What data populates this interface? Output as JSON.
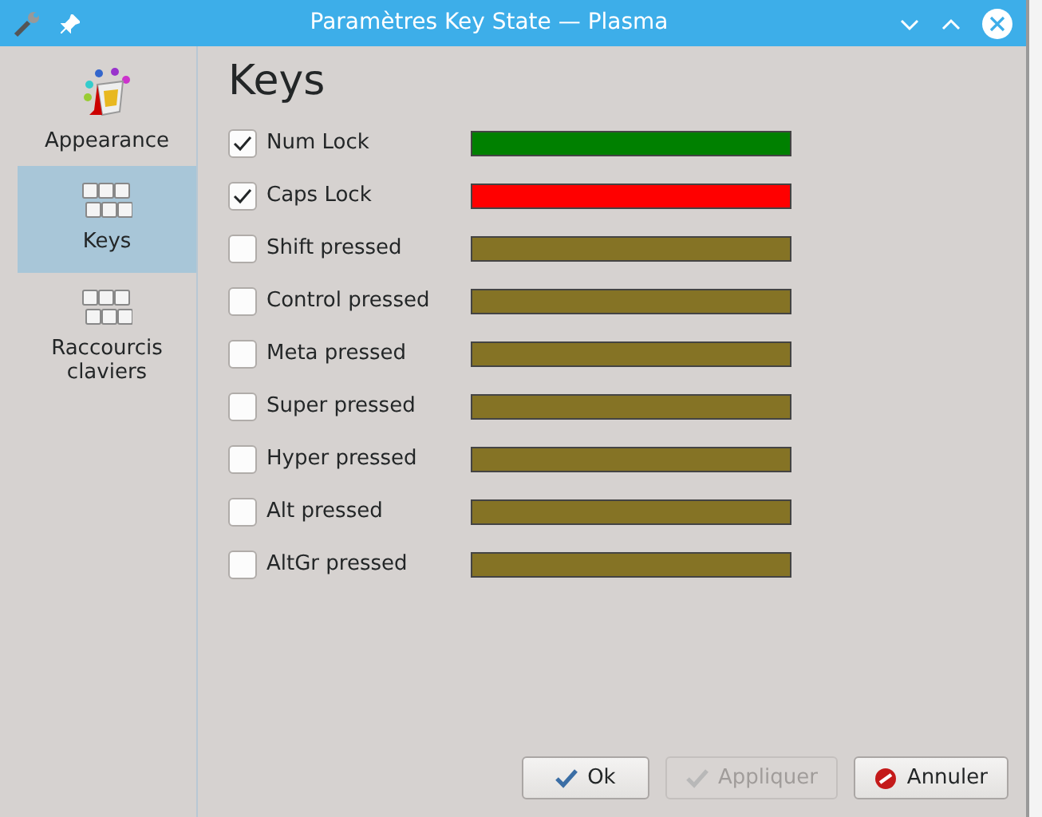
{
  "window": {
    "title": "Paramètres Key State — Plasma"
  },
  "sidebar": {
    "items": [
      {
        "label": "Appearance",
        "kind": "paint",
        "selected": false
      },
      {
        "label": "Keys",
        "kind": "keys",
        "selected": true
      },
      {
        "label": "Raccourcis claviers",
        "kind": "keys",
        "selected": false
      }
    ]
  },
  "page": {
    "title": "Keys"
  },
  "keys": [
    {
      "label": "Num Lock",
      "checked": true,
      "color": "#008000"
    },
    {
      "label": "Caps Lock",
      "checked": true,
      "color": "#ff0000"
    },
    {
      "label": "Shift pressed",
      "checked": false,
      "color": "#857325"
    },
    {
      "label": "Control pressed",
      "checked": false,
      "color": "#857325"
    },
    {
      "label": "Meta pressed",
      "checked": false,
      "color": "#857325"
    },
    {
      "label": "Super pressed",
      "checked": false,
      "color": "#857325"
    },
    {
      "label": "Hyper pressed",
      "checked": false,
      "color": "#857325"
    },
    {
      "label": "Alt pressed",
      "checked": false,
      "color": "#857325"
    },
    {
      "label": "AltGr pressed",
      "checked": false,
      "color": "#857325"
    }
  ],
  "buttons": [
    {
      "label": "Ok",
      "kind": "ok",
      "disabled": false
    },
    {
      "label": "Appliquer",
      "kind": "apply",
      "disabled": true
    },
    {
      "label": "Annuler",
      "kind": "cancel",
      "disabled": false
    }
  ]
}
